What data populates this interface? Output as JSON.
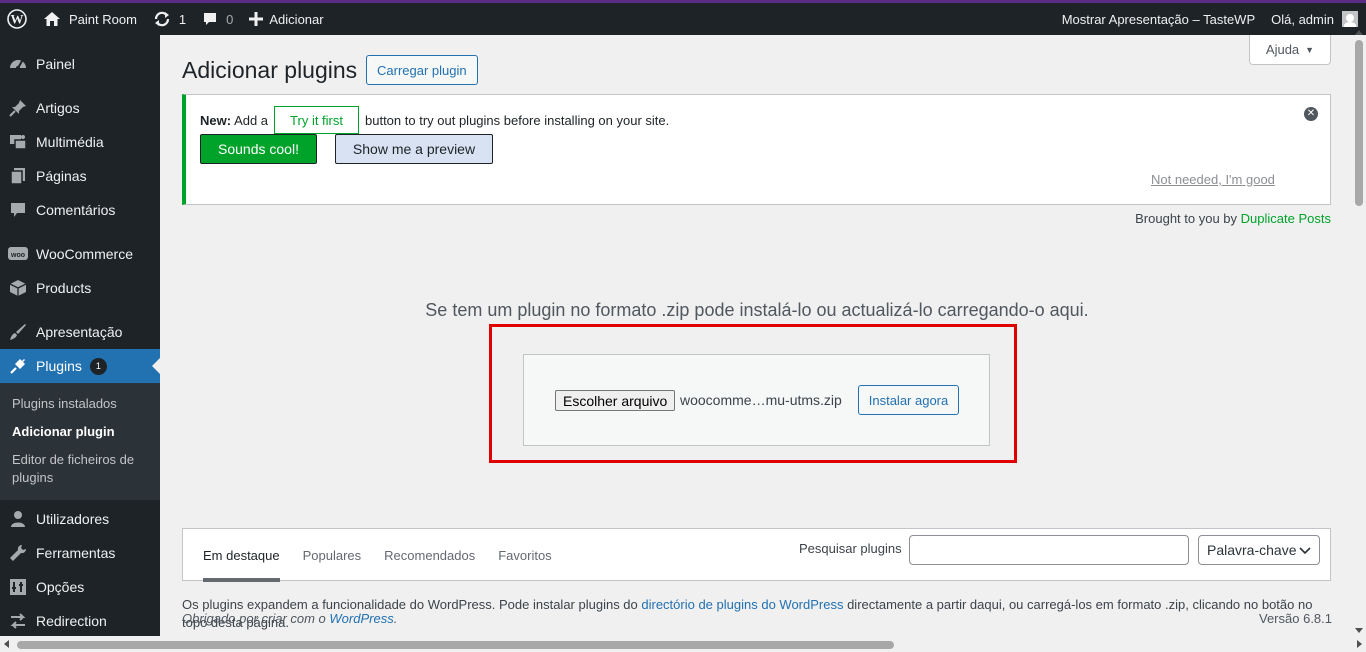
{
  "adminbar": {
    "site_name": "Paint Room",
    "updates_count": "1",
    "comments_count": "0",
    "new_label": "Adicionar",
    "show_label": "Mostrar Apresentação – TasteWP",
    "greeting": "Olá, admin"
  },
  "sidebar": {
    "items": [
      {
        "label": "Painel",
        "icon": "dashboard-icon"
      },
      {
        "label": "Artigos",
        "icon": "pin-icon"
      },
      {
        "label": "Multimédia",
        "icon": "media-icon"
      },
      {
        "label": "Páginas",
        "icon": "pages-icon"
      },
      {
        "label": "Comentários",
        "icon": "comments-icon"
      },
      {
        "label": "WooCommerce",
        "icon": "woo-icon"
      },
      {
        "label": "Products",
        "icon": "archive-icon"
      },
      {
        "label": "Apresentação",
        "icon": "brush-icon"
      },
      {
        "label": "Plugins",
        "icon": "plugin-icon",
        "badge": "1"
      },
      {
        "label": "Utilizadores",
        "icon": "users-icon"
      },
      {
        "label": "Ferramentas",
        "icon": "tools-icon"
      },
      {
        "label": "Opções",
        "icon": "settings-icon"
      },
      {
        "label": "Redirection",
        "icon": "redirection-icon"
      }
    ],
    "submenu": [
      "Plugins instalados",
      "Adicionar plugin",
      "Editor de ficheiros de plugins"
    ]
  },
  "main": {
    "help_label": "Ajuda",
    "title": "Adicionar plugins",
    "upload_button": "Carregar plugin",
    "notice": {
      "new_label": "New:",
      "add_a": "Add a",
      "try_button": "Try it first",
      "rest": "button to try out plugins before installing on your site.",
      "sounds_button": "Sounds cool!",
      "preview_button": "Show me a preview",
      "not_needed": "Not needed, I'm good"
    },
    "brought_prefix": "Brought to you by",
    "brought_link": "Duplicate Posts",
    "upload_text": "Se tem um plugin no formato .zip pode instalá-lo ou actualizá-lo carregando-o aqui.",
    "choose_file": "Escolher arquivo",
    "file_name": "woocomme…mu-utms.zip",
    "install_button": "Instalar agora",
    "tabs": [
      "Em destaque",
      "Populares",
      "Recomendados",
      "Favoritos"
    ],
    "search_label": "Pesquisar plugins",
    "search_value": "",
    "search_type": "Palavra-chave",
    "desc_before": "Os plugins expandem a funcionalidade do WordPress. Pode instalar plugins do ",
    "desc_link": "directório de plugins do WordPress",
    "desc_after": " directamente a partir daqui, ou carregá-los em formato .zip, clicando no botão no topo desta página.",
    "footer_text": "Obrigado por criar com o ",
    "footer_link": "WordPress",
    "footer_end": ".",
    "version": "Versão 6.8.1"
  },
  "colors": {
    "adminbar_bg": "#1d2327",
    "accent": "#2271b1",
    "green": "#00a32a",
    "highlight_red": "#e00000"
  }
}
